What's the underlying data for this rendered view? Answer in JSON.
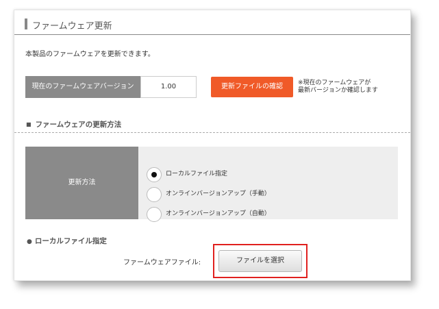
{
  "page": {
    "title": "ファームウェア更新",
    "intro": "本製品のファームウェアを更新できます。"
  },
  "version": {
    "label": "現在のファームウェアバージョン",
    "value": "1.00",
    "check_button_label": "更新ファイルの確認",
    "note_line1": "※現在のファームウェアが",
    "note_line2": "最新バージョンか確認します"
  },
  "update_method": {
    "section_marker": "■",
    "section_title": "ファームウェアの更新方法",
    "label": "更新方法",
    "options": [
      {
        "label": "ローカルファイル指定",
        "selected": true
      },
      {
        "label": "オンラインバージョンアップ（手動）",
        "selected": false
      },
      {
        "label": "オンラインバージョンアップ（自動）",
        "selected": false
      }
    ]
  },
  "local_file": {
    "section_marker": "●",
    "section_title": "ローカルファイル指定",
    "file_label": "ファームウェアファイル:",
    "select_button_label": "ファイルを選択"
  },
  "colors": {
    "accent_orange": "#f05a28",
    "label_gray": "#8a8a8a",
    "highlight_red": "#e0201e",
    "table_bg": "#eeeeee"
  }
}
